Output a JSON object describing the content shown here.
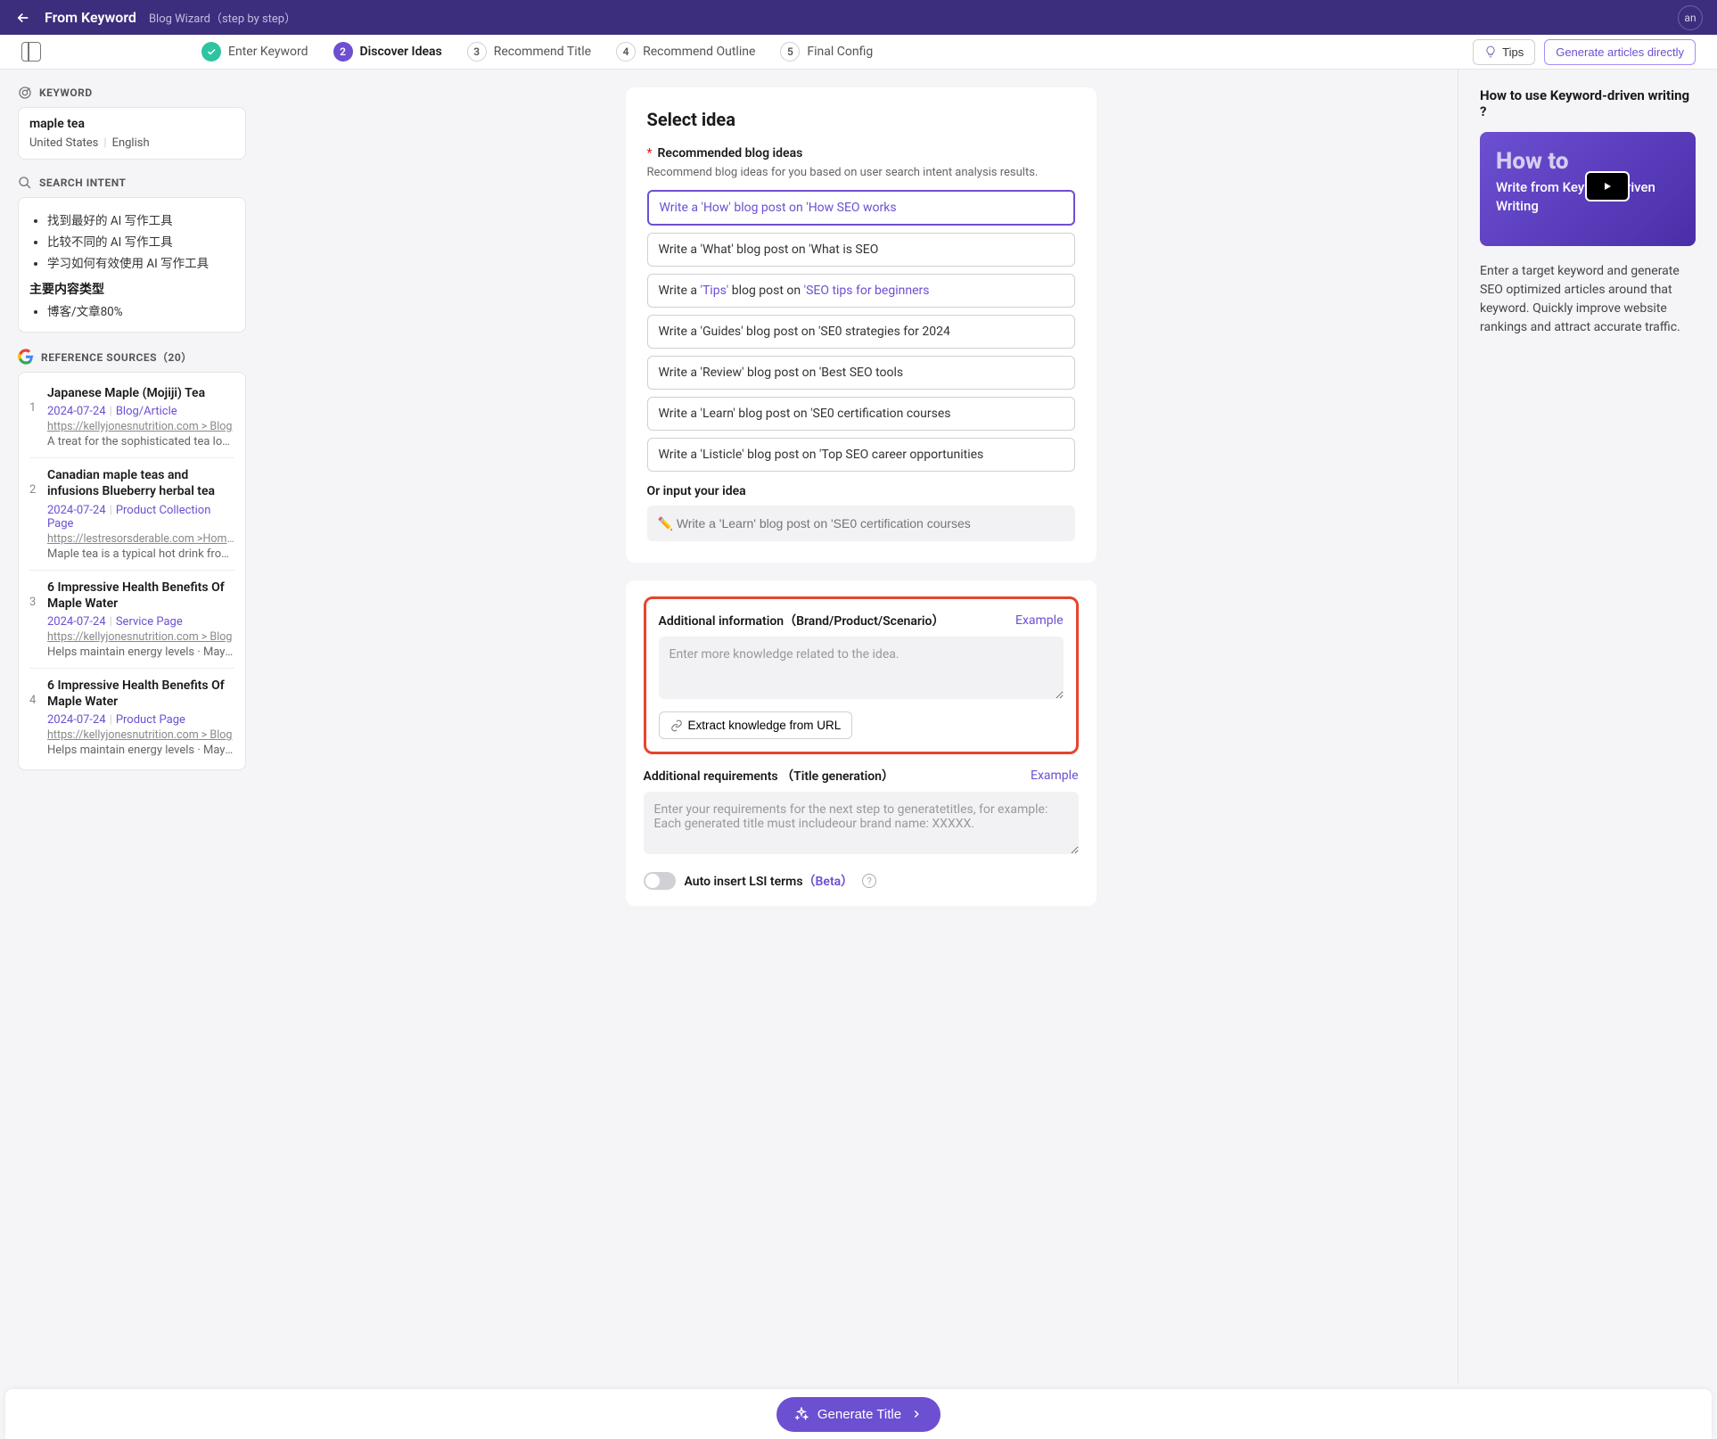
{
  "topbar": {
    "title": "From Keyword",
    "subtitle": "Blog Wizard（step by step）",
    "avatar": "an"
  },
  "steps": {
    "items": [
      {
        "num": "✓",
        "label": "Enter Keyword",
        "state": "done"
      },
      {
        "num": "2",
        "label": "Discover Ideas",
        "state": "current"
      },
      {
        "num": "3",
        "label": "Recommend Title",
        "state": "future"
      },
      {
        "num": "4",
        "label": "Recommend Outline",
        "state": "future"
      },
      {
        "num": "5",
        "label": "Final Config",
        "state": "future"
      }
    ],
    "tips_btn": "Tips",
    "generate_btn": "Generate articles directly"
  },
  "sidebar": {
    "keyword_heading": "KEYWORD",
    "keyword": "maple tea",
    "country": "United States",
    "language": "English",
    "intent_heading": "SEARCH INTENT",
    "intent_items": [
      "找到最好的 AI 写作工具",
      "比较不同的 AI 写作工具",
      "学习如何有效使用 AI 写作工具"
    ],
    "intent_subheading": "主要内容类型",
    "intent_type": "博客/文章80%",
    "ref_heading": "REFERENCE SOURCES（20）",
    "refs": [
      {
        "n": "1",
        "title": "Japanese Maple (Mojiji) Tea",
        "date": "2024-07-24",
        "type": "Blog/Article",
        "url": "https://kellyjonesnutrition.com > Blog",
        "desc": "A treat for the sophisticated tea lover. Ma…"
      },
      {
        "n": "2",
        "title": "Canadian maple teas and infusions Blueberry herbal tea",
        "date": "2024-07-24",
        "type": "Product Collection Page",
        "url": "https://lestresorsderable.com >Home >Drinks",
        "desc": "Maple tea is a typical hot drink from Cana…"
      },
      {
        "n": "3",
        "title": "6 Impressive Health Benefits Of Maple Water",
        "date": "2024-07-24",
        "type": "Service Page",
        "url": "https://kellyjonesnutrition.com > Blog",
        "desc": "Helps maintain energy levels · May suppo…"
      },
      {
        "n": "4",
        "title": "6 Impressive Health Benefits Of Maple Water",
        "date": "2024-07-24",
        "type": "Product Page",
        "url": "https://kellyjonesnutrition.com > Blog",
        "desc": "Helps maintain energy levels · May suppo…"
      }
    ]
  },
  "main": {
    "heading": "Select idea",
    "rec_label": "Recommended blog ideas",
    "rec_help": "Recommend blog ideas for you based on user search intent analysis results.",
    "ideas": [
      {
        "pre": "Write a ",
        "q1": "'How'",
        "mid": " blog post on ",
        "q2": "'How SEO works",
        "selected": true,
        "hl": false
      },
      {
        "pre": "Write a ",
        "q1": "'What'",
        "mid": " blog post on ",
        "q2": "'What is SEO",
        "selected": false,
        "hl": false
      },
      {
        "pre": "Write a ",
        "q1": "'Tips'",
        "mid": " blog post on ",
        "q2": "'SEO tips for beginners",
        "selected": false,
        "hl": true
      },
      {
        "pre": "Write a ",
        "q1": "'Guides'",
        "mid": " blog post on ",
        "q2": "'SE0 strategies for 2024",
        "selected": false,
        "hl": false
      },
      {
        "pre": "Write a ",
        "q1": "'Review'",
        "mid": " blog post on ",
        "q2": "'Best SEO tools",
        "selected": false,
        "hl": false
      },
      {
        "pre": "Write a ",
        "q1": "'Learn'",
        "mid": " blog post on ",
        "q2": "'SE0 certification courses",
        "selected": false,
        "hl": false
      },
      {
        "pre": "Write a ",
        "q1": "'Listicle'",
        "mid": " blog post on ",
        "q2": "'Top SEO career opportunities",
        "selected": false,
        "hl": false
      }
    ],
    "or_label": "Or input your idea",
    "idea_placeholder": "✏️ Write a 'Learn' blog post on 'SE0 certification courses",
    "addl_info_label": "Additional information（Brand/Product/Scenario）",
    "example_btn": "Example",
    "addl_info_placeholder": "Enter more knowledge related to the idea.",
    "extract_btn": "Extract knowledge from URL",
    "addl_req_label": "Additional requirements （Title generation）",
    "addl_req_placeholder": "Enter your requirements for the next step to generatetitles, for example: Each generated title must includeour brand name: XXXXX.",
    "lsi_label": "Auto insert LSI terms",
    "lsi_beta": "（Beta）"
  },
  "right": {
    "heading": "How to use Keyword-driven writing ?",
    "video_howto": "How to",
    "video_sub": "Write from Keyword-driven Writing",
    "body": "Enter a target keyword and generate SEO optimized articles around that keyword. Quickly improve website rankings and attract accurate traffic."
  },
  "bottom": {
    "cta": "Generate Title"
  }
}
